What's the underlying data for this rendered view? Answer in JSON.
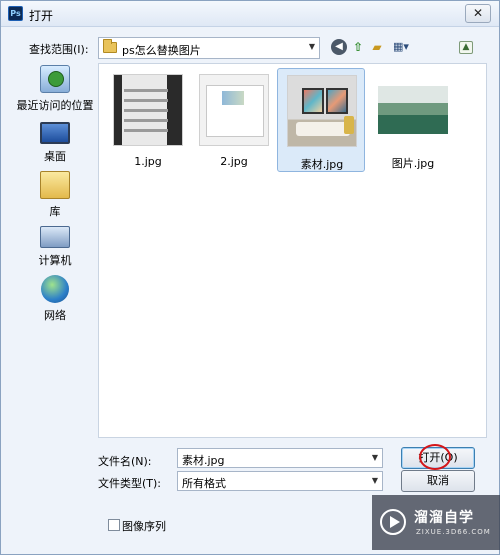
{
  "window": {
    "app_icon": "ps-icon",
    "app_icon_text": "Ps",
    "title": "打开",
    "close_label": "✕"
  },
  "toolbar": {
    "look_in_label": "查找范围(I):",
    "look_in_value": "ps怎么替换图片",
    "icons": [
      "back-icon",
      "up-folder-icon",
      "new-folder-icon",
      "views-menu-icon",
      "extra-icon"
    ]
  },
  "places": [
    {
      "label": "最近访问的位置",
      "icon": "recent-places-icon"
    },
    {
      "label": "桌面",
      "icon": "desktop-icon"
    },
    {
      "label": "库",
      "icon": "library-icon"
    },
    {
      "label": "计算机",
      "icon": "computer-icon"
    },
    {
      "label": "网络",
      "icon": "network-icon"
    }
  ],
  "files": [
    {
      "name": "1.jpg",
      "selected": false
    },
    {
      "name": "2.jpg",
      "selected": false
    },
    {
      "name": "素材.jpg",
      "selected": true
    },
    {
      "name": "图片.jpg",
      "selected": false
    }
  ],
  "form": {
    "filename_label": "文件名(N):",
    "filename_value": "素材.jpg",
    "filetype_label": "文件类型(T):",
    "filetype_value": "所有格式",
    "open_button": "打开(O)",
    "cancel_button": "取消",
    "image_sequence_label": "图像序列"
  },
  "watermark": {
    "title": "溜溜自学",
    "subtitle": "ZIXUE.3D66.COM"
  },
  "colors": {
    "window_bg": "#eef3fa",
    "selection": "#dbeaf9",
    "highlight_circle": "#d4161a"
  }
}
